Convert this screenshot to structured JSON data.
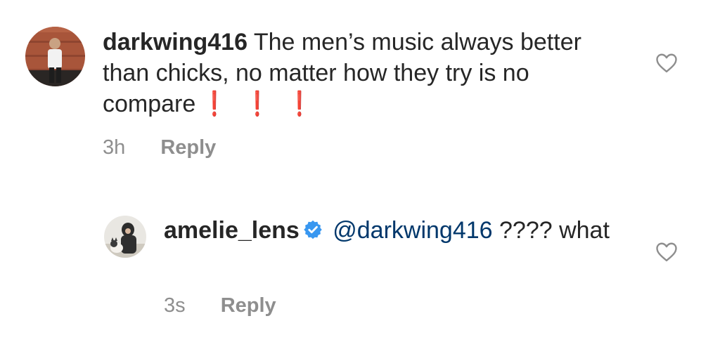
{
  "comments": [
    {
      "username": "darkwing416",
      "text": "The men’s music always better than chicks, no matter how they try is no compare",
      "emoji": [
        "❗",
        "❗",
        "❗"
      ],
      "time": "3h",
      "reply_label": "Reply",
      "like_icon": "heart-outline-icon"
    },
    {
      "username": "amelie_lens",
      "verified": true,
      "verified_icon": "verified-badge-icon",
      "mention": "@darkwing416",
      "text": "???? what",
      "time": "3s",
      "reply_label": "Reply",
      "like_icon": "heart-outline-icon"
    }
  ],
  "colors": {
    "text": "#262626",
    "secondary": "#8e8e8e",
    "mention": "#00376b",
    "verified": "#3897f0",
    "emoji_red": "#d0021b"
  }
}
